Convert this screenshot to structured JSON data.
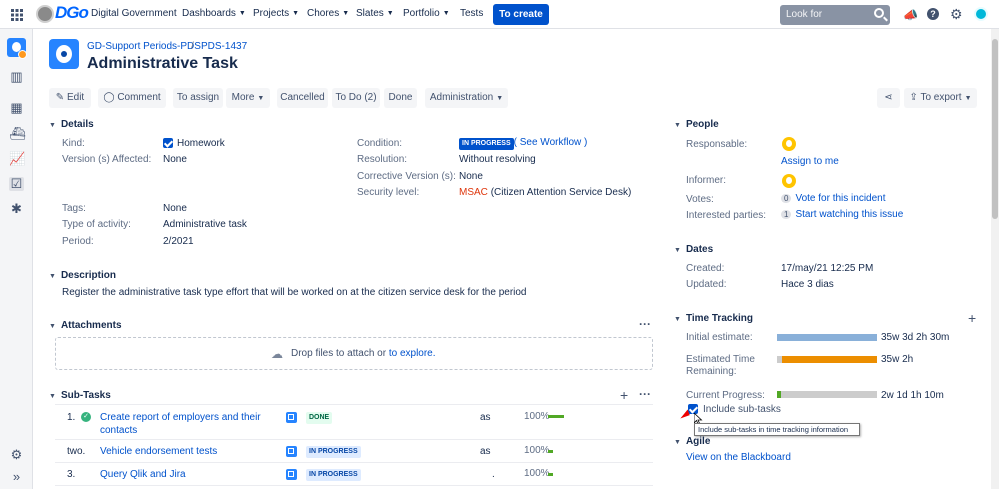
{
  "topbar": {
    "logo_text": "DGo",
    "app_name": "Digital Government",
    "nav": [
      "Dashboards",
      "Projects",
      "Chores",
      "Slates",
      "Portfolio",
      "Tests"
    ],
    "create_label": "To create",
    "search_placeholder": "Look for"
  },
  "issue": {
    "project": "GD-Support Periods-PDS",
    "key": "PDS-1437",
    "title": "Administrative Task"
  },
  "toolbar": {
    "edit": "Edit",
    "comment": "Comment",
    "assign": "To assign",
    "more": "More",
    "cancelled": "Cancelled",
    "todo": "To Do (2)",
    "done": "Done",
    "administration": "Administration",
    "export": "To export"
  },
  "details": {
    "heading": "Details",
    "kind_label": "Kind:",
    "kind_value": "Homework",
    "version_label": "Version (s) Affected:",
    "version_value": "None",
    "tags_label": "Tags:",
    "tags_value": "None",
    "activity_label": "Type of activity:",
    "activity_value": "Administrative task",
    "period_label": "Period:",
    "period_value": "2/2021",
    "condition_label": "Condition:",
    "condition_value": "IN PROGRESS",
    "workflow_open": "( ",
    "workflow_link": "See Workflow",
    "workflow_close": " )",
    "resolution_label": "Resolution:",
    "resolution_value": "Without resolving",
    "corrective_label": "Corrective Version (s):",
    "corrective_value": "None",
    "security_label": "Security level:",
    "security_code": "MSAC",
    "security_desc": "(Citizen Attention Service Desk)"
  },
  "description": {
    "heading": "Description",
    "text": "Register the administrative task type effort that will be worked on at the citizen service desk for the period"
  },
  "attachments": {
    "heading": "Attachments",
    "drop_text": "Drop files to attach or ",
    "explore_link": "to explore."
  },
  "subtasks": {
    "heading": "Sub-Tasks",
    "items": [
      {
        "num": "1.",
        "title1": "Create report of employers and their",
        "title2": "contacts",
        "status": "DONE",
        "assignee": "as",
        "pct": "100%"
      },
      {
        "num": "two.",
        "title1": "Vehicle endorsement tests",
        "title2": "",
        "status": "IN PROGRESS",
        "assignee": "as",
        "pct": "100%"
      },
      {
        "num": "3.",
        "title1": "Query Qlik and Jira",
        "title2": "",
        "status": "IN PROGRESS",
        "assignee": ".",
        "pct": "100%"
      }
    ]
  },
  "people": {
    "heading": "People",
    "responsible_label": "Responsable:",
    "assign_me": "Assign to me",
    "informer_label": "Informer:",
    "votes_label": "Votes:",
    "votes_count": "0",
    "votes_link": "Vote for this incident",
    "interested_label": "Interested parties:",
    "interested_count": "1",
    "interested_link": "Start watching this issue"
  },
  "dates": {
    "heading": "Dates",
    "created_label": "Created:",
    "created_value": "17/may/21 12:25 PM",
    "updated_label": "Updated:",
    "updated_value": "Hace 3 dias"
  },
  "time_tracking": {
    "heading": "Time Tracking",
    "initial_label": "Initial estimate:",
    "initial_value": "35w 3d 2h 30m",
    "estimated_label1": "Estimated Time",
    "estimated_label2": "Remaining:",
    "estimated_value": "35w 2h",
    "current_label": "Current Progress:",
    "current_value": "2w 1d 1h 10m",
    "current_progress": 0.04,
    "include_label": "Include sub-tasks",
    "tooltip": "Include sub-tasks in time tracking information",
    "colors": {
      "initial": "#89b0d9",
      "remaining": "#ec8e00",
      "logged": "#51a825",
      "track": "#ccc"
    }
  },
  "agile": {
    "heading": "Agile",
    "link": "View on the Blackboard"
  }
}
